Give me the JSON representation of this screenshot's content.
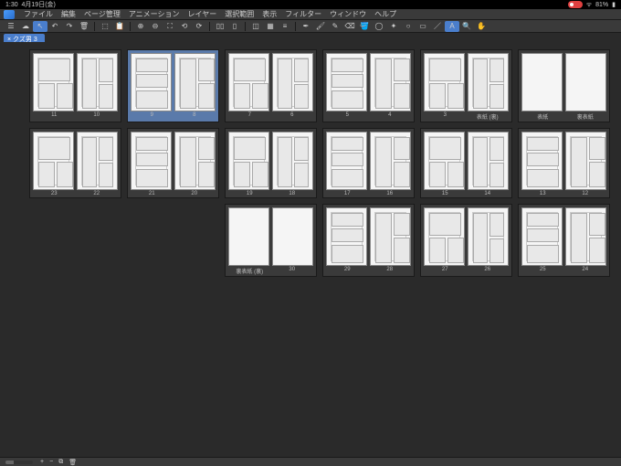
{
  "status": {
    "time": "1:30",
    "date": "4月19日(金)",
    "battery": "81%"
  },
  "menu": [
    "ファイル",
    "編集",
    "ページ管理",
    "アニメーション",
    "レイヤー",
    "選択範囲",
    "表示",
    "フィルター",
    "ウィンドウ",
    "ヘルプ"
  ],
  "tab": "クズ男 3",
  "spreads": [
    [
      {
        "l": "11",
        "r": "10",
        "sel": false,
        "kind": "manga"
      },
      {
        "l": "9",
        "r": "8",
        "sel": true,
        "kind": "manga"
      },
      {
        "l": "7",
        "r": "6",
        "sel": false,
        "kind": "manga"
      },
      {
        "l": "5",
        "r": "4",
        "sel": false,
        "kind": "manga"
      },
      {
        "l": "3",
        "r": "表紙 (裏)",
        "sel": false,
        "kind": "half"
      },
      {
        "l": "表紙",
        "r": "裏表紙",
        "sel": false,
        "kind": "cover"
      }
    ],
    [
      {
        "l": "23",
        "r": "22",
        "sel": false,
        "kind": "manga"
      },
      {
        "l": "21",
        "r": "20",
        "sel": false,
        "kind": "manga"
      },
      {
        "l": "19",
        "r": "18",
        "sel": false,
        "kind": "manga"
      },
      {
        "l": "17",
        "r": "16",
        "sel": false,
        "kind": "manga"
      },
      {
        "l": "15",
        "r": "14",
        "sel": false,
        "kind": "manga"
      },
      {
        "l": "13",
        "r": "12",
        "sel": false,
        "kind": "manga"
      }
    ],
    [
      {
        "l": "裏表紙 (裏)",
        "r": "30",
        "sel": false,
        "kind": "back"
      },
      {
        "l": "29",
        "r": "28",
        "sel": false,
        "kind": "manga"
      },
      {
        "l": "27",
        "r": "26",
        "sel": false,
        "kind": "manga"
      },
      {
        "l": "25",
        "r": "24",
        "sel": false,
        "kind": "manga"
      }
    ]
  ],
  "toolbar_icons": [
    "menu-icon",
    "cloud-icon",
    "cursor-icon",
    "undo-icon",
    "redo-icon",
    "trash-icon",
    "sep",
    "crop-icon",
    "clipboard-icon",
    "sep",
    "zoom-in-icon",
    "zoom-out-icon",
    "zoom-fit-icon",
    "rotate-left-icon",
    "rotate-right-icon",
    "sep",
    "spread-icon",
    "single-icon",
    "sep",
    "geometry-icon",
    "grid-icon",
    "align-icon",
    "sep",
    "pen-icon",
    "brush-icon",
    "pencil-icon",
    "eraser-icon",
    "bucket-icon",
    "lasso-icon",
    "wand-icon",
    "circle-icon",
    "rect-icon",
    "line-icon",
    "text-icon",
    "zoom-icon",
    "hand-icon"
  ],
  "toolbar_active_index": 2,
  "text_tool_index": 33,
  "bottom_icons": [
    "plus-icon",
    "minus-icon",
    "duplicate-icon",
    "trash-icon"
  ]
}
